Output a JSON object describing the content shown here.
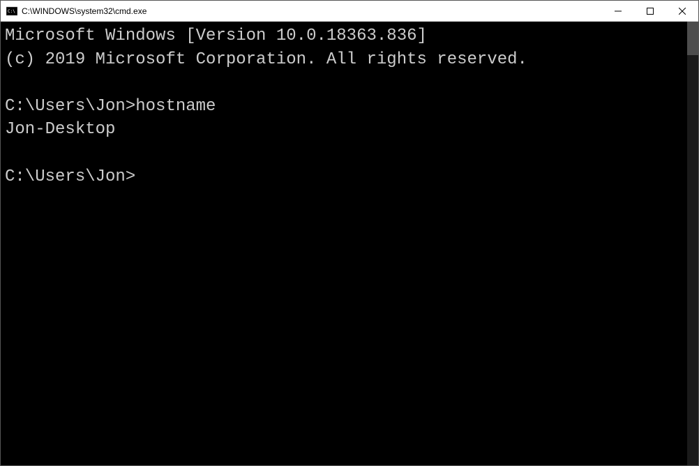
{
  "window": {
    "title": "C:\\WINDOWS\\system32\\cmd.exe"
  },
  "terminal": {
    "line1": "Microsoft Windows [Version 10.0.18363.836]",
    "line2": "(c) 2019 Microsoft Corporation. All rights reserved.",
    "prompt1": "C:\\Users\\Jon>",
    "command1": "hostname",
    "output1": "Jon-Desktop",
    "prompt2": "C:\\Users\\Jon>"
  }
}
